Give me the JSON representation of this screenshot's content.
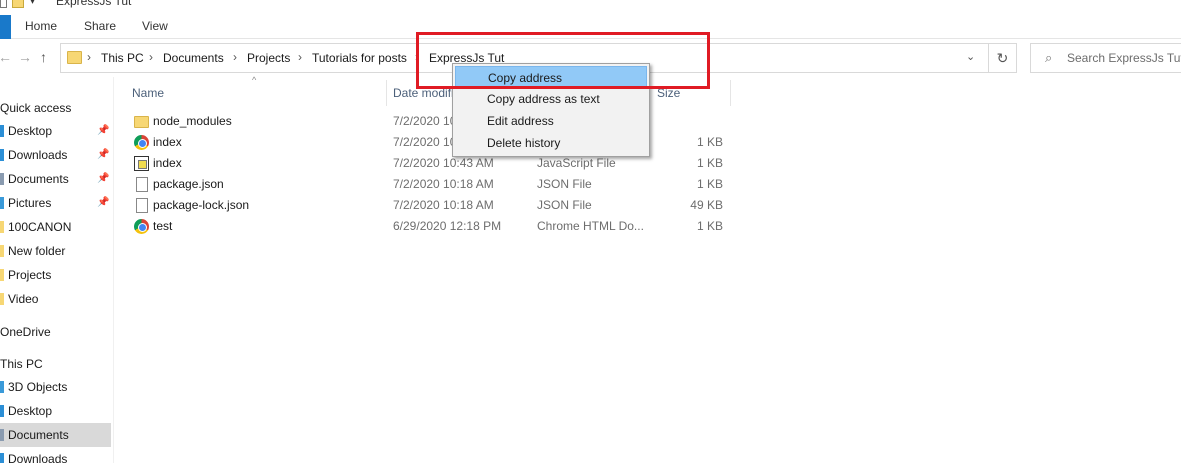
{
  "window": {
    "title": "ExpressJs Tut"
  },
  "ribbon": {
    "tabs": [
      "Home",
      "Share",
      "View"
    ]
  },
  "nav": {
    "back_icon": "back-arrow-icon",
    "forward_icon": "forward-arrow-icon",
    "up_icon": "up-arrow-icon",
    "breadcrumbs": [
      "This PC",
      "Documents",
      "Projects",
      "Tutorials for posts",
      "ExpressJs Tut"
    ]
  },
  "search": {
    "placeholder": "Search ExpressJs Tut"
  },
  "sidebar": {
    "quick_access": "Quick access",
    "quick_items": [
      {
        "label": "Desktop",
        "pinned": true
      },
      {
        "label": "Downloads",
        "pinned": true
      },
      {
        "label": "Documents",
        "pinned": true
      },
      {
        "label": "Pictures",
        "pinned": true
      },
      {
        "label": "100CANON",
        "pinned": false
      },
      {
        "label": "New folder",
        "pinned": false
      },
      {
        "label": "Projects",
        "pinned": false
      },
      {
        "label": "Video",
        "pinned": false
      }
    ],
    "onedrive": "OneDrive",
    "this_pc": "This PC",
    "pc_items": [
      {
        "label": "3D Objects"
      },
      {
        "label": "Desktop"
      },
      {
        "label": "Documents",
        "selected": true
      },
      {
        "label": "Downloads"
      }
    ]
  },
  "columns": {
    "name": "Name",
    "date": "Date modified",
    "size": "Size"
  },
  "files": [
    {
      "name": "node_modules",
      "date": "7/2/2020 10:18 AM",
      "type": "",
      "size": "",
      "icon": "folder-icon"
    },
    {
      "name": "index",
      "date": "7/2/2020 10:43 AM",
      "type": "",
      "size": "1 KB",
      "icon": "chrome-icon"
    },
    {
      "name": "index",
      "date": "7/2/2020 10:43 AM",
      "type": "JavaScript File",
      "size": "1 KB",
      "icon": "js-file-icon"
    },
    {
      "name": "package.json",
      "date": "7/2/2020 10:18 AM",
      "type": "JSON File",
      "size": "1 KB",
      "icon": "file-icon"
    },
    {
      "name": "package-lock.json",
      "date": "7/2/2020 10:18 AM",
      "type": "JSON File",
      "size": "49 KB",
      "icon": "file-icon"
    },
    {
      "name": "test",
      "date": "6/29/2020 12:18 PM",
      "type": "Chrome HTML Do...",
      "size": "1 KB",
      "icon": "chrome-icon"
    }
  ],
  "context_menu": {
    "items": [
      "Copy address",
      "Copy address as text",
      "Edit address",
      "Delete history"
    ],
    "highlighted": "Copy address"
  },
  "colors": {
    "accent": "#1979ca",
    "menu_highlight": "#91c9f7",
    "annotation": "#e01b24"
  }
}
